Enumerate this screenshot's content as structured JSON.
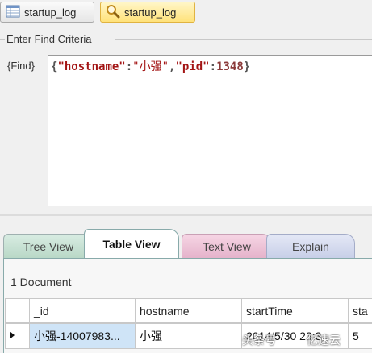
{
  "tabs": [
    {
      "label": "startup_log",
      "icon": "table-icon"
    },
    {
      "label": "startup_log",
      "icon": "search-icon"
    }
  ],
  "find": {
    "group_label": "Enter Find Criteria",
    "field_label": "{Find}",
    "query": {
      "open": "{",
      "key1": "\"hostname\"",
      "colon": ":",
      "val1": "\"小强\"",
      "comma": ",",
      "key2": "\"pid\"",
      "val2": "1348",
      "close": "}"
    }
  },
  "view_tabs": [
    "Tree View",
    "Table View",
    "Text View",
    "Explain"
  ],
  "results": {
    "count": "1 Document",
    "columns": [
      "_id",
      "hostname",
      "startTime",
      "sta"
    ],
    "row": [
      "小强-14007983...",
      "小强",
      "2014/5/30 23:3",
      "5"
    ]
  },
  "watermark": {
    "left": "头条号",
    "right": "亿速云"
  }
}
